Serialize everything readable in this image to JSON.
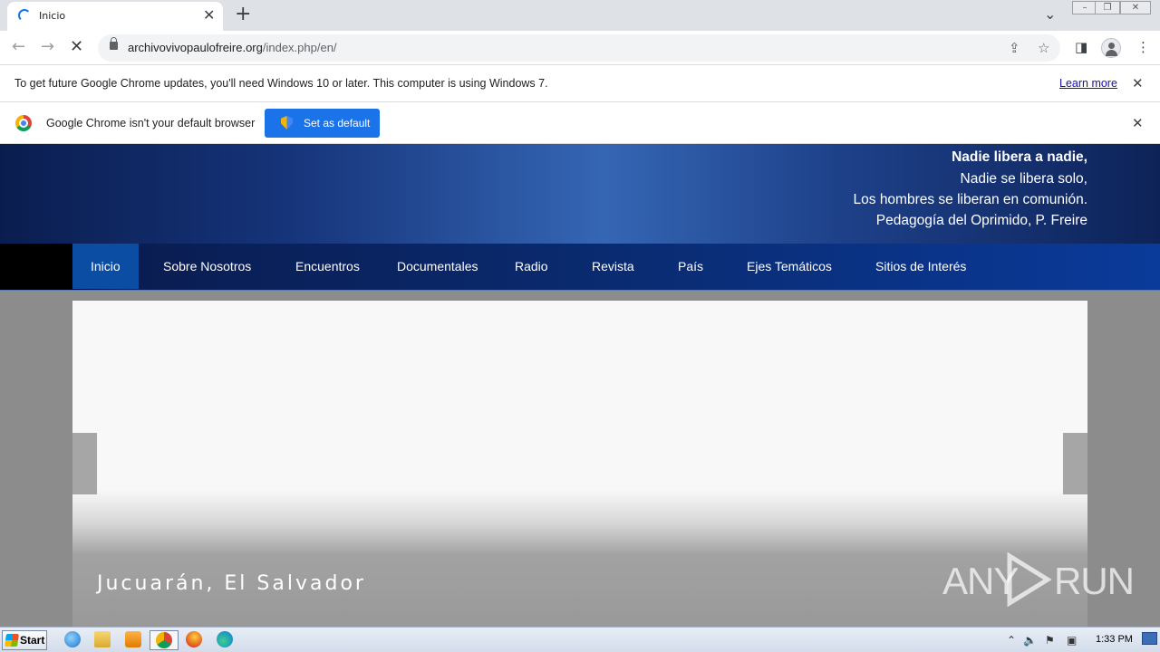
{
  "browser": {
    "tab": {
      "title": "Inicio"
    },
    "url": {
      "host": "archivovivopaulofreire.org",
      "path": "/index.php/en/"
    }
  },
  "infobars": {
    "update": {
      "message": "To get future Google Chrome updates, you'll need Windows 10 or later. This computer is using Windows 7.",
      "link": "Learn more"
    },
    "default_browser": {
      "message": "Google Chrome isn't your default browser",
      "button": "Set as default"
    }
  },
  "site": {
    "quote": {
      "line1": "Nadie libera a nadie,",
      "line2": "Nadie se libera solo,",
      "line3": "Los hombres se liberan en comunión.",
      "line4": "Pedagogía del Oprimido,  P. Freire"
    },
    "nav": [
      {
        "label": "Inicio"
      },
      {
        "label": "Sobre Nosotros"
      },
      {
        "label": "Encuentros"
      },
      {
        "label": "Documentales"
      },
      {
        "label": "Radio"
      },
      {
        "label": "Revista"
      },
      {
        "label": "País"
      },
      {
        "label": "Ejes Temáticos"
      },
      {
        "label": "Sitios de Interés"
      }
    ],
    "slider": {
      "caption": "Jucuarán, El Salvador"
    }
  },
  "watermark": {
    "left": "ANY",
    "right": "RUN"
  },
  "taskbar": {
    "start": "Start",
    "clock": "1:33 PM"
  },
  "colors": {
    "accent": "#1a73e8",
    "nav_active": "#0b4da2"
  }
}
